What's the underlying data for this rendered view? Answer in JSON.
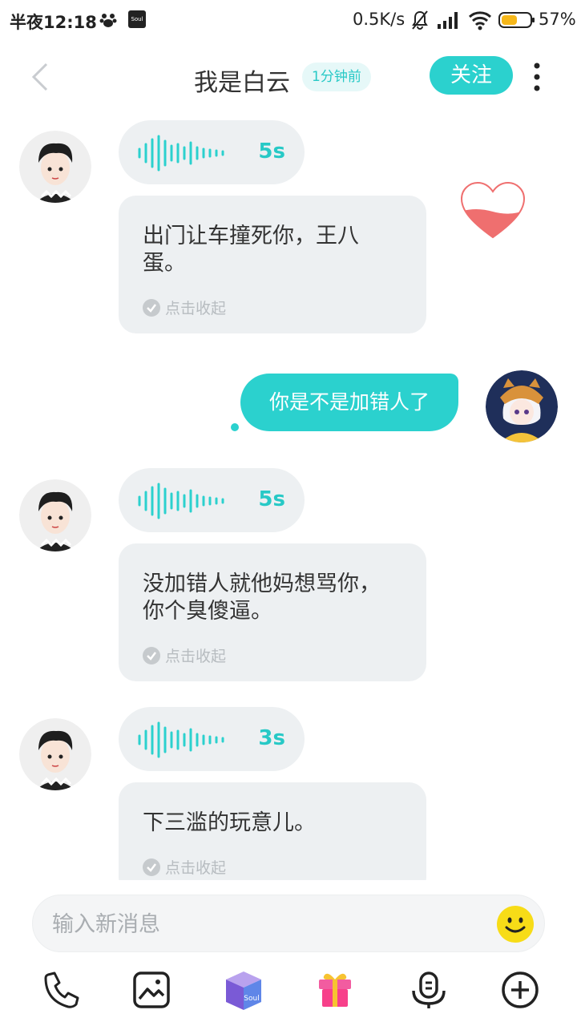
{
  "status_bar": {
    "time": "半夜12:18",
    "soul_icon_text": "Soul",
    "network_speed": "0.5K/s",
    "battery_percent": "57%",
    "battery_level": 0.57,
    "icons": [
      "paw-icon",
      "soul-app-icon",
      "mute-bell-icon",
      "signal-icon",
      "wifi-icon",
      "battery-icon"
    ]
  },
  "header": {
    "title": "我是白云",
    "time_badge": "1分钟前",
    "follow_label": "关注",
    "icons": [
      "back-icon",
      "more-icon"
    ]
  },
  "messages": [
    {
      "type": "voice",
      "side": "left",
      "duration": "5s"
    },
    {
      "type": "text",
      "side": "left",
      "text": "出门让车撞死你，王八蛋。",
      "collapse_label": "点击收起"
    },
    {
      "type": "text",
      "side": "right",
      "text": "你是不是加错人了"
    },
    {
      "type": "voice",
      "side": "left",
      "duration": "5s"
    },
    {
      "type": "text",
      "side": "left",
      "text": "没加错人就他妈想骂你，你个臭傻逼。",
      "collapse_label": "点击收起"
    },
    {
      "type": "voice",
      "side": "left",
      "duration": "3s"
    },
    {
      "type": "text",
      "side": "left",
      "text": "下三滥的玩意儿。",
      "collapse_label": "点击收起"
    }
  ],
  "input": {
    "placeholder": "输入新消息"
  },
  "toolbar": {
    "box_label": "Soul",
    "icons": [
      "phone-icon",
      "image-icon",
      "soul-box-icon",
      "gift-icon",
      "voice-match-icon",
      "add-icon"
    ]
  },
  "colors": {
    "accent": "#2bd1ce",
    "bubble_gray": "#edf0f2",
    "heart": "#ef6f6f"
  }
}
